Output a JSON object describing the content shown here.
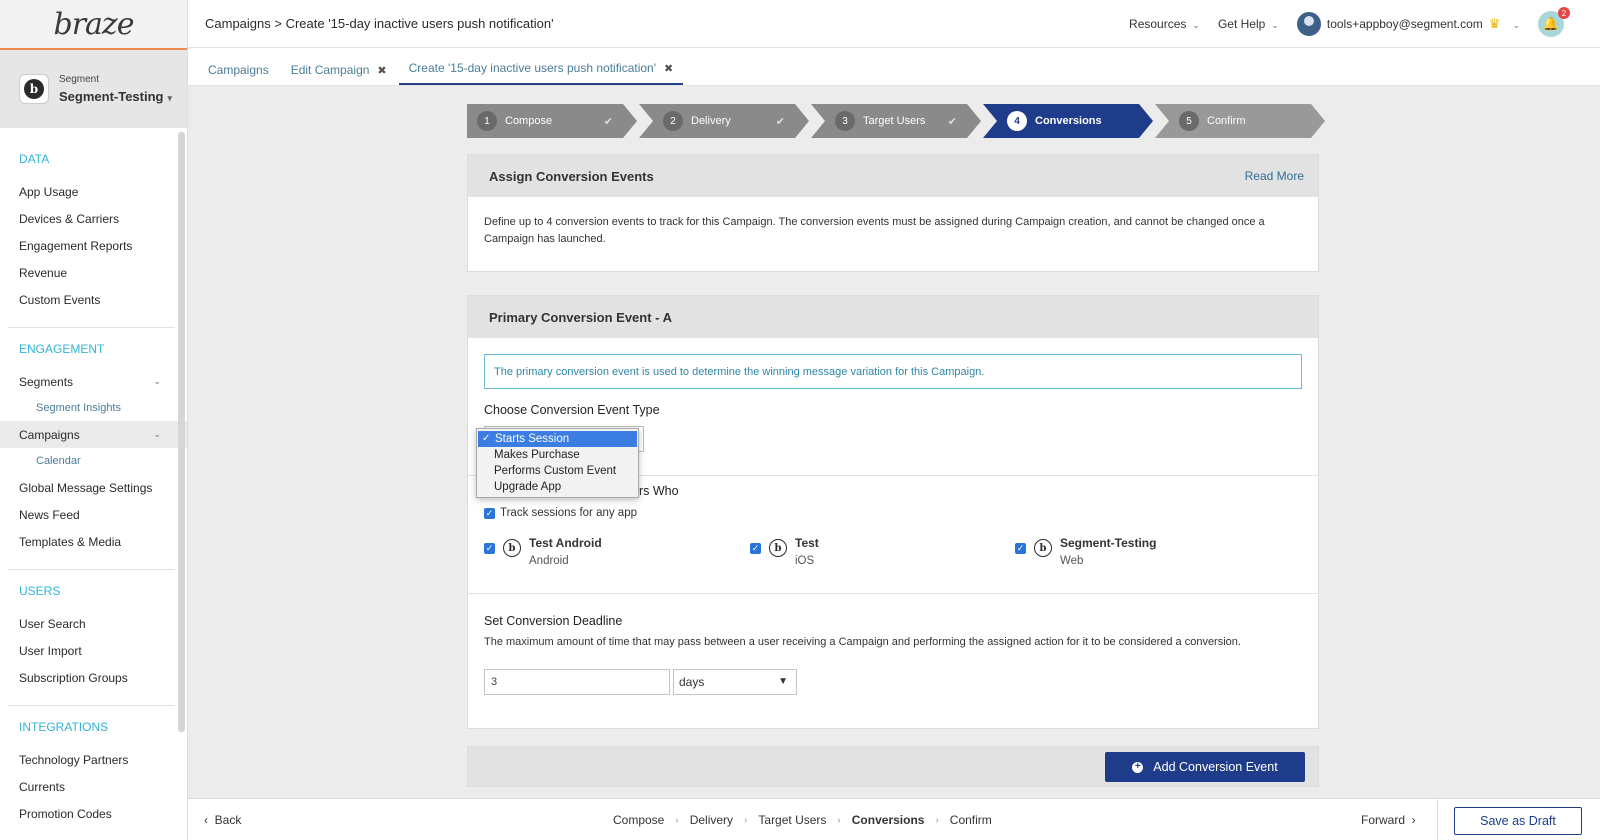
{
  "app": {
    "logo": "braze"
  },
  "workspace": {
    "label": "Segment",
    "name": "Segment-Testing"
  },
  "breadcrumb": "Campaigns > Create '15-day inactive users push notification'",
  "topbar": {
    "resources": "Resources",
    "get_help": "Get Help",
    "user_email": "tools+appboy@segment.com",
    "notifications": "2"
  },
  "sidebar": {
    "data": {
      "heading": "DATA",
      "items": [
        "App Usage",
        "Devices & Carriers",
        "Engagement Reports",
        "Revenue",
        "Custom Events"
      ]
    },
    "engagement": {
      "heading": "ENGAGEMENT",
      "segments": "Segments",
      "segment_insights": "Segment Insights",
      "campaigns": "Campaigns",
      "calendar": "Calendar",
      "global": "Global Message Settings",
      "news": "News Feed",
      "templates": "Templates & Media"
    },
    "users": {
      "heading": "USERS",
      "items": [
        "User Search",
        "User Import",
        "Subscription Groups"
      ]
    },
    "integrations": {
      "heading": "INTEGRATIONS",
      "items": [
        "Technology Partners",
        "Currents",
        "Promotion Codes"
      ]
    }
  },
  "tabs": [
    {
      "label": "Campaigns"
    },
    {
      "label": "Edit Campaign"
    },
    {
      "label": "Create '15-day inactive users push notification'"
    }
  ],
  "stepper": [
    {
      "num": "1",
      "label": "Compose"
    },
    {
      "num": "2",
      "label": "Delivery"
    },
    {
      "num": "3",
      "label": "Target Users"
    },
    {
      "num": "4",
      "label": "Conversions"
    },
    {
      "num": "5",
      "label": "Confirm"
    }
  ],
  "assign": {
    "title": "Assign Conversion Events",
    "read_more": "Read More",
    "description": "Define up to 4 conversion events to track for this Campaign. The conversion events must be assigned during Campaign creation, and cannot be changed once a Campaign has launched."
  },
  "primary": {
    "title": "Primary Conversion Event - A",
    "info": "The primary conversion event is used to determine the winning message variation for this Campaign.",
    "choose_type": "Choose Conversion Event Type",
    "options": [
      "Starts Session",
      "Makes Purchase",
      "Performs Custom Event",
      "Upgrade App"
    ],
    "track_title": "ers Who",
    "track_any": "Track sessions for any app",
    "apps": [
      {
        "name": "Test Android",
        "platform": "Android"
      },
      {
        "name": "Test",
        "platform": "iOS"
      },
      {
        "name": "Segment-Testing",
        "platform": "Web"
      }
    ],
    "deadline_title": "Set Conversion Deadline",
    "deadline_desc": "The maximum amount of time that may pass between a user receiving a Campaign and performing the assigned action for it to be considered a conversion.",
    "deadline_value": "3",
    "deadline_unit": "days"
  },
  "add_event": "Add Conversion Event",
  "footer": {
    "back": "Back",
    "steps": [
      "Compose",
      "Delivery",
      "Target Users",
      "Conversions",
      "Confirm"
    ],
    "forward": "Forward",
    "save_draft": "Save as Draft"
  },
  "colors": {
    "accent": "#1f3c8a",
    "link": "#33b3d6",
    "brand_line": "#f28b50"
  }
}
